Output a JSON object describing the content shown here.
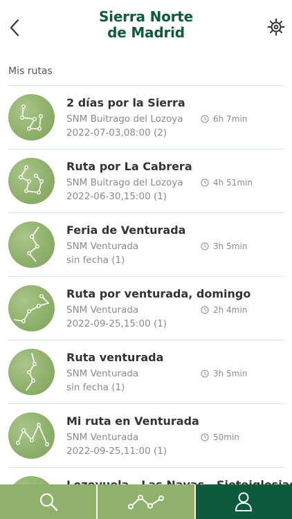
{
  "header": {
    "logo_line1": "Sierra Norte",
    "logo_line2": "de Madrid",
    "back_icon": "chevron-left-icon",
    "settings_icon": "gear-icon"
  },
  "section": {
    "title": "Mis rutas"
  },
  "colors": {
    "brand": "#0e5a3d",
    "accent": "#8fb16c",
    "divider": "#cde8e5"
  },
  "routes": [
    {
      "title": "2 días por la Sierra",
      "location": "SNM Buitrago del Lozoya",
      "duration": "6h 7min",
      "date": "2022-07-03,08:00 (2)"
    },
    {
      "title": "Ruta por La Cabrera",
      "location": "SNM Buitrago del Lozoya",
      "duration": "4h 51min",
      "date": "2022-06-30,15:00 (1)"
    },
    {
      "title": "Feria de Venturada",
      "location": "SNM Venturada",
      "duration": "3h 5min",
      "date": "sin fecha (1)"
    },
    {
      "title": "Ruta por venturada, domingo",
      "location": "SNM Venturada",
      "duration": "2h 4min",
      "date": "2022-09-25,15:00 (1)"
    },
    {
      "title": "Ruta venturada",
      "location": "SNM Venturada",
      "duration": "3h 5min",
      "date": "sin fecha (1)"
    },
    {
      "title": "Mi ruta en Venturada",
      "location": "SNM Venturada",
      "duration": "50min",
      "date": "2022-09-25,11:00 (1)"
    },
    {
      "title": "Lozoyuela - Las Navas - Sieteiglesias",
      "location": "",
      "duration": "",
      "date": ""
    }
  ],
  "tabbar": {
    "tabs": [
      {
        "icon": "search-icon",
        "active": false
      },
      {
        "icon": "route-icon",
        "active": false
      },
      {
        "icon": "user-icon",
        "active": true
      }
    ]
  }
}
